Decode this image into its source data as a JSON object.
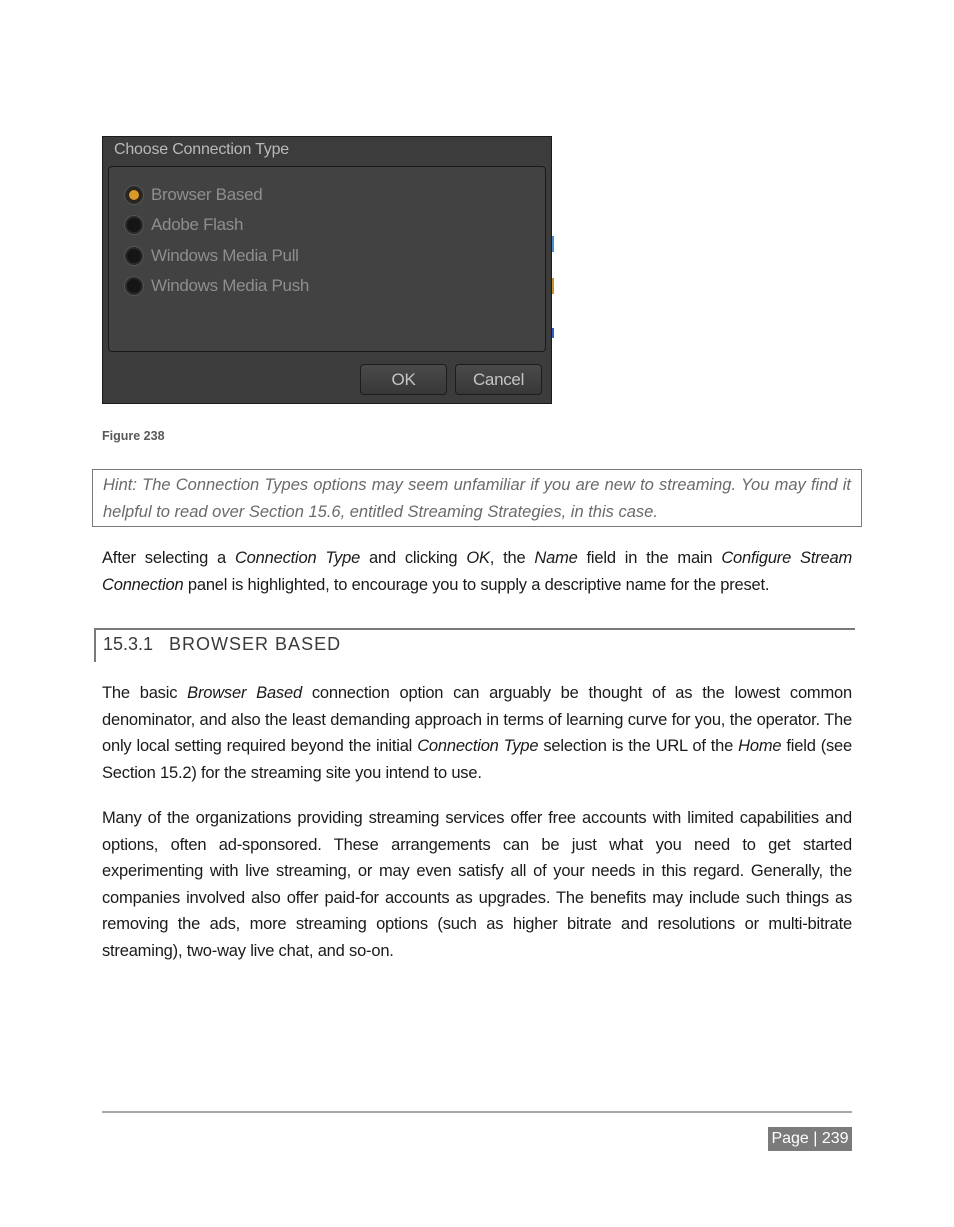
{
  "dialog": {
    "title": "Choose Connection Type",
    "options": [
      {
        "label": "Browser Based",
        "checked": true
      },
      {
        "label": "Adobe Flash",
        "checked": false
      },
      {
        "label": "Windows Media Pull",
        "checked": false
      },
      {
        "label": "Windows Media Push",
        "checked": false
      }
    ],
    "ok_label": "OK",
    "cancel_label": "Cancel",
    "accent_color": "#d79a2b"
  },
  "figure_caption": "Figure 238",
  "hint": "Hint: The Connection Types options may seem unfamiliar if you are new to streaming.  You may find it helpful to read over Section 15.6, entitled Streaming Strategies, in this case.",
  "paragraph1": {
    "parts": [
      "After selecting a ",
      "Connection Type",
      " and clicking ",
      "OK",
      ", the ",
      "Name",
      " field in the main ",
      "Configure Stream Connection",
      " panel is highlighted, to encourage you to supply a descriptive name for the preset."
    ]
  },
  "section": {
    "number": "15.3.1",
    "title": "BROWSER BASED"
  },
  "paragraph2": {
    "parts": [
      "The basic ",
      "Browser Based",
      " connection option can arguably be thought of as the lowest common denominator, and also the least demanding approach in terms of learning curve for you, the operator.  The only local setting required beyond the initial ",
      "Connection Type",
      " selection is the URL of the ",
      "Home",
      " field (see Section 15.2) for the streaming site you intend to use."
    ]
  },
  "paragraph3": "Many of the organizations providing streaming services offer free accounts with limited capabilities and options, often ad-sponsored.  These arrangements can be just what you need to get started experimenting with live streaming, or may even satisfy all of your needs in this regard.  Generally, the companies involved also offer paid-for accounts as upgrades.  The benefits may include such things as removing the ads, more streaming options (such as higher bitrate and resolutions or multi-bitrate streaming), two-way live chat, and so-on.",
  "footer": {
    "page_label": "Page | 239"
  }
}
